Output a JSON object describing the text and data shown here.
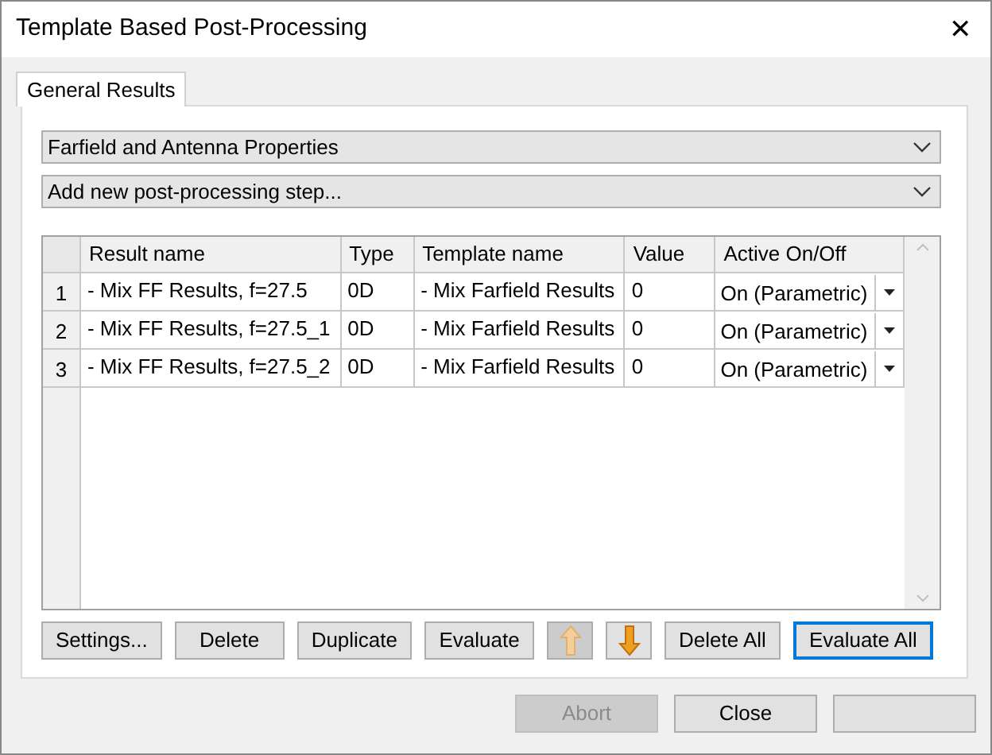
{
  "window": {
    "title": "Template Based Post-Processing",
    "close": "✕"
  },
  "tabs": [
    {
      "label": "General Results",
      "selected": true
    }
  ],
  "category_dropdown": {
    "value": "Farfield and Antenna Properties"
  },
  "step_dropdown": {
    "value": "Add new post-processing step..."
  },
  "table": {
    "columns": [
      "Result name",
      "Type",
      "Template name",
      "Value",
      "Active On/Off"
    ],
    "rows": [
      {
        "index": "1",
        "cells": [
          "- Mix FF Results, f=27.5",
          "0D",
          "- Mix Farfield Results",
          "0",
          "On (Parametric)"
        ]
      },
      {
        "index": "2",
        "cells": [
          "- Mix FF Results, f=27.5_1",
          "0D",
          "- Mix Farfield Results",
          "0",
          "On (Parametric)"
        ]
      },
      {
        "index": "3",
        "cells": [
          "- Mix FF Results, f=27.5_2",
          "0D",
          "- Mix Farfield Results",
          "0",
          "On (Parametric)"
        ]
      }
    ]
  },
  "actions": [
    {
      "kind": "text",
      "label": "Settings...",
      "disabled": false,
      "focused": false
    },
    {
      "kind": "text",
      "label": "Delete",
      "disabled": false,
      "focused": false
    },
    {
      "kind": "text",
      "label": "Duplicate",
      "disabled": false,
      "focused": false
    },
    {
      "kind": "text",
      "label": "Evaluate",
      "disabled": false,
      "focused": false
    },
    {
      "kind": "up",
      "disabled": true,
      "focused": false
    },
    {
      "kind": "down",
      "disabled": false,
      "focused": false
    },
    {
      "kind": "text",
      "label": "Delete All",
      "disabled": false,
      "focused": false
    },
    {
      "kind": "text",
      "label": "Evaluate All",
      "disabled": false,
      "focused": true
    }
  ],
  "dialog_buttons": [
    {
      "label": "Abort",
      "disabled": true
    },
    {
      "label": "Close",
      "disabled": false
    },
    {
      "disabled": false
    }
  ]
}
